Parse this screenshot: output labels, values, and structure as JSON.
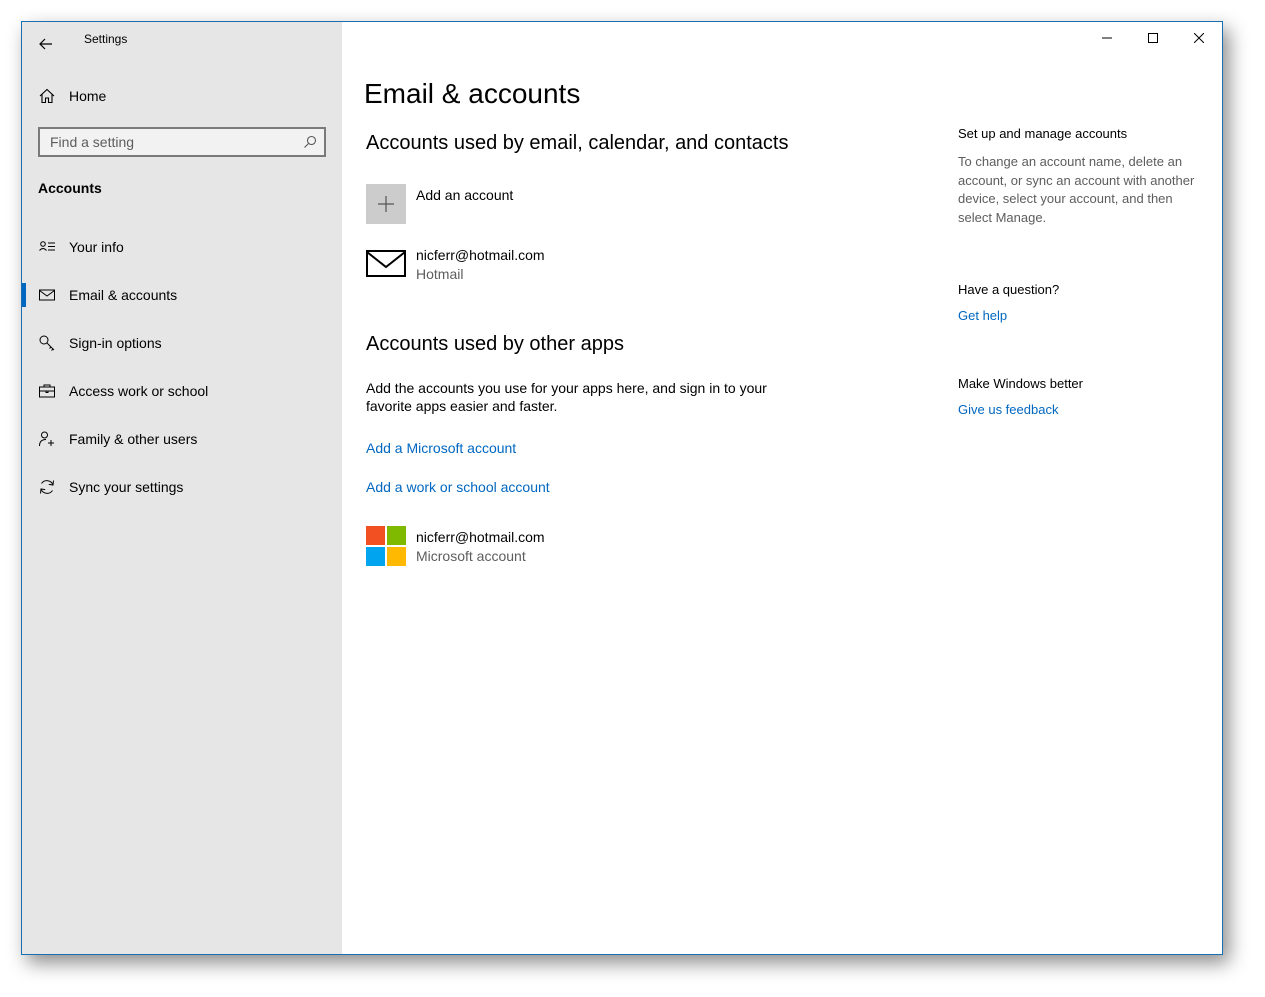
{
  "window": {
    "title": "Settings",
    "minimize_glyph": "—",
    "maximize_glyph": "☐",
    "close_glyph": "✕"
  },
  "sidebar": {
    "home_label": "Home",
    "search": {
      "placeholder": "Find a setting",
      "value": ""
    },
    "section_title": "Accounts",
    "items": [
      {
        "label": "Your info",
        "icon": "contact-info-icon",
        "active": false
      },
      {
        "label": "Email & accounts",
        "icon": "mail-icon",
        "active": true
      },
      {
        "label": "Sign-in options",
        "icon": "key-icon",
        "active": false
      },
      {
        "label": "Access work or school",
        "icon": "briefcase-icon",
        "active": false
      },
      {
        "label": "Family & other users",
        "icon": "add-person-icon",
        "active": false
      },
      {
        "label": "Sync your settings",
        "icon": "sync-icon",
        "active": false
      }
    ]
  },
  "main": {
    "page_title": "Email & accounts",
    "email_section": {
      "heading": "Accounts used by email, calendar, and contacts",
      "add_account_label": "Add an account",
      "accounts": [
        {
          "email": "nicferr@hotmail.com",
          "provider": "Hotmail",
          "icon": "mail-envelope-icon"
        }
      ]
    },
    "other_apps_section": {
      "heading": "Accounts used by other apps",
      "description": "Add the accounts you use for your apps here, and sign in to your favorite apps easier and faster.",
      "add_microsoft_link": "Add a Microsoft account",
      "add_work_link": "Add a work or school account",
      "accounts": [
        {
          "email": "nicferr@hotmail.com",
          "type": "Microsoft account",
          "icon": "microsoft-logo-icon"
        }
      ]
    }
  },
  "related": {
    "manage": {
      "heading": "Set up and manage accounts",
      "text": "To change an account name, delete an account, or sync an account with another device, select your account, and then select Manage."
    },
    "question": {
      "heading": "Have a question?",
      "link": "Get help"
    },
    "feedback": {
      "heading": "Make Windows better",
      "link": "Give us feedback"
    }
  },
  "colors": {
    "accent": "#0067c0",
    "sidebar_bg": "#e6e6e6",
    "ms_red": "#f25022",
    "ms_green": "#7fba00",
    "ms_blue": "#00a4ef",
    "ms_yellow": "#ffb900"
  }
}
